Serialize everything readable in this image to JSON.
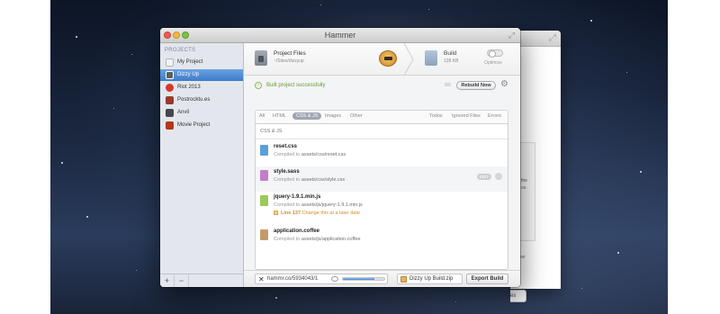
{
  "window": {
    "title": "Hammer"
  },
  "sidebar": {
    "heading": "PROJECTS",
    "items": [
      {
        "label": "My Project",
        "icon": "blank-project-icon",
        "color": "#d9dde3"
      },
      {
        "label": "Dizzy Up",
        "icon": "dizzy-up-project-icon",
        "color": "#5b5f66",
        "selected": true
      },
      {
        "label": "Riot 2013",
        "icon": "riot-project-icon",
        "color": "#d9352b"
      },
      {
        "label": "Postrocktu.es",
        "icon": "postrock-project-icon",
        "color": "#9a3a2c"
      },
      {
        "label": "Anvil",
        "icon": "anvil-project-icon",
        "color": "#44474c"
      },
      {
        "label": "Movie Project",
        "icon": "movie-project-icon",
        "color": "#b5371f"
      }
    ],
    "footer": {
      "add": "+",
      "remove": "−"
    }
  },
  "header": {
    "project_files": {
      "title": "Project Files",
      "path": "~/Sites/dizzyup"
    },
    "build": {
      "title": "Build",
      "size": "128 KB",
      "optimize": "Optimize"
    }
  },
  "status": {
    "text": "Built project successfully",
    "count": "8/0",
    "rebuild": "Rebuild Now"
  },
  "filters": {
    "left": [
      "All",
      "HTML",
      "CSS & JS",
      "Images",
      "Other"
    ],
    "active": "CSS & JS",
    "right": [
      "Todos",
      "Ignored Files",
      "Errors"
    ]
  },
  "files": {
    "section": "CSS & JS",
    "items": [
      {
        "name": "reset.css",
        "prefix": "Compiled to ",
        "path": "assets/css/reset.css",
        "icon_color": "#5aa0d8"
      },
      {
        "name": "style.sass",
        "prefix": "Compiled to ",
        "path": "assets/css/style.css",
        "icon_color": "#c27fc9",
        "edit": "EDIT"
      },
      {
        "name": "jquery-1.9.1.min.js",
        "prefix": "Compiled to ",
        "path": "assets/js/jquery-1.9.1.min.js",
        "icon_color": "#9bc95a",
        "note_line": "Line 137",
        "note_text": " Change this at a later date"
      },
      {
        "name": "application.coffee",
        "prefix": "Compiled to ",
        "path": "assets/js/application.coffee",
        "icon_color": "#c59a6a"
      }
    ]
  },
  "bottom": {
    "url": "hammr.co/5934043/1",
    "progress": 0.75,
    "zip": "Dizzy Up Build.zip",
    "export": "Export Build"
  },
  "back_window": {
    "lines": [
      "the",
      "ce.",
      "mmer",
      "m:",
      "es"
    ]
  }
}
